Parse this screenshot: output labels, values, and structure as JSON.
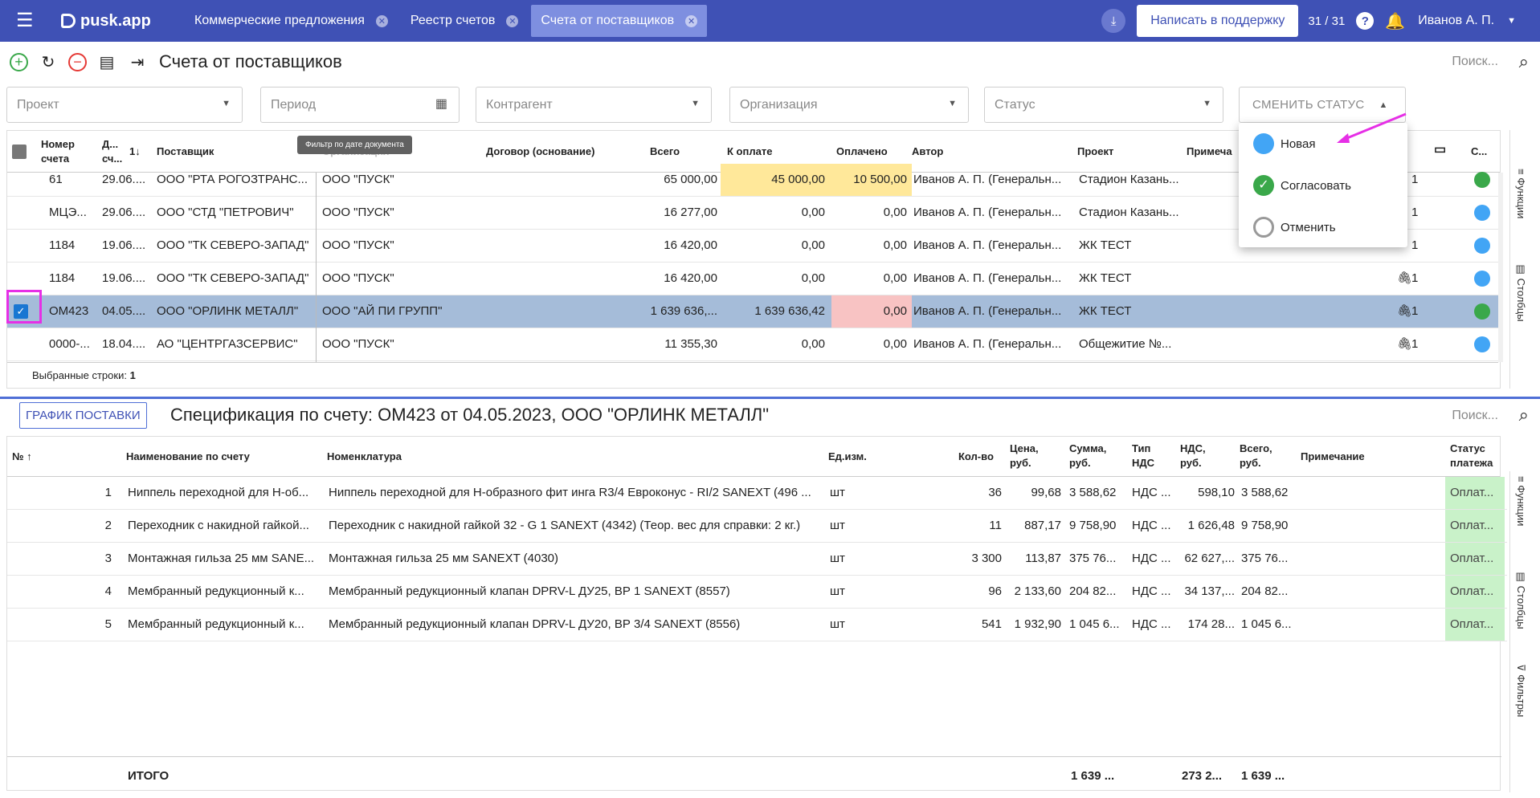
{
  "topbar": {
    "logo": "pusk.app",
    "tabs": [
      "Коммерческие предложения",
      "Реестр счетов",
      "Счета от поставщиков"
    ],
    "support": "Написать в поддержку",
    "count": "31 / 31",
    "help": "?",
    "user": "Иванов А. П."
  },
  "toolbar": {
    "title": "Счета от поставщиков",
    "search": "Поиск..."
  },
  "filters": {
    "project": "Проект",
    "period": "Период",
    "counterparty": "Контрагент",
    "organization": "Организация",
    "status": "Статус",
    "change_status": "СМЕНИТЬ СТАТУС"
  },
  "tooltip": "Фильтр по дате документа",
  "status_menu": [
    "Новая",
    "Согласовать",
    "Отменить"
  ],
  "grid1": {
    "headers": {
      "num": "Номер счета",
      "date": "Д... сч...",
      "sort": "1",
      "supplier": "Поставщик",
      "org": "Организация",
      "contract": "Договор (основание)",
      "total": "Всего",
      "to_pay": "К оплате",
      "paid": "Оплачено",
      "author": "Автор",
      "project": "Проект",
      "note": "Примеча",
      "st": "С..."
    },
    "rows": [
      {
        "num": "61",
        "date": "29.06....",
        "supplier": "ООО \"РТА РОГОЗТРАНС...",
        "org": "ООО \"ПУСК\"",
        "total": "65 000,00",
        "to_pay": "45 000,00",
        "paid": "10 500,00",
        "author": "Иванов А. П. (Генеральн...",
        "project": "Стадион Казань...",
        "att": "1",
        "status": "green"
      },
      {
        "num": "МЦЭ...",
        "date": "29.06....",
        "supplier": "ООО \"СТД \"ПЕТРОВИЧ\"",
        "org": "ООО \"ПУСК\"",
        "total": "16 277,00",
        "to_pay": "0,00",
        "paid": "0,00",
        "author": "Иванов А. П. (Генеральн...",
        "project": "Стадион Казань...",
        "att": "1",
        "status": "blue"
      },
      {
        "num": "1184",
        "date": "19.06....",
        "supplier": "ООО \"ТК СЕВЕРО-ЗАПАД\"",
        "org": "ООО \"ПУСК\"",
        "total": "16 420,00",
        "to_pay": "0,00",
        "paid": "0,00",
        "author": "Иванов А. П. (Генеральн...",
        "project": "ЖК ТЕСТ",
        "att": "1",
        "status": "blue"
      },
      {
        "num": "1184",
        "date": "19.06....",
        "supplier": "ООО \"ТК СЕВЕРО-ЗАПАД\"",
        "org": "ООО \"ПУСК\"",
        "total": "16 420,00",
        "to_pay": "0,00",
        "paid": "0,00",
        "author": "Иванов А. П. (Генеральн...",
        "project": "ЖК ТЕСТ",
        "att": "1",
        "status": "blue"
      },
      {
        "num": "ОМ423",
        "date": "04.05....",
        "supplier": "ООО \"ОРЛИНК МЕТАЛЛ\"",
        "org": "ООО \"АЙ ПИ ГРУПП\"",
        "total": "1 639 636,...",
        "to_pay": "1 639 636,42",
        "paid": "0,00",
        "author": "Иванов А. П. (Генеральн...",
        "project": "ЖК ТЕСТ",
        "att": "1",
        "status": "green"
      },
      {
        "num": "0000-...",
        "date": "18.04....",
        "supplier": "АО \"ЦЕНТРГАЗСЕРВИС\"",
        "org": "ООО \"ПУСК\"",
        "total": "11 355,30",
        "to_pay": "0,00",
        "paid": "0,00",
        "author": "Иванов А. П. (Генеральн...",
        "project": "Общежитие №...",
        "att": "1",
        "status": "blue"
      }
    ],
    "selected_label": "Выбранные строки:",
    "selected_count": "1",
    "side_functions": "Функции",
    "side_columns": "Столбцы"
  },
  "spec": {
    "schedule_btn": "ГРАФИК ПОСТАВКИ",
    "title": "Спецификация по счету: ОМ423 от 04.05.2023, ООО \"ОРЛИНК МЕТАЛЛ\"",
    "search": "Поиск...",
    "headers": {
      "no": "№",
      "name": "Наименование по счету",
      "nom": "Номенклатура",
      "unit": "Ед.изм.",
      "qty": "Кол-во",
      "price": "Цена, руб.",
      "sum": "Сумма, руб.",
      "vat_type": "Тип НДС",
      "vat": "НДС, руб.",
      "total": "Всего, руб.",
      "note": "Примечание",
      "pay": "Статус платежа"
    },
    "rows": [
      {
        "no": "1",
        "name": "Ниппель переходной для Н-об...",
        "nom": "Ниппель переходной для Н-образного фит инга R3/4 Евроконус - RI/2 SANEXT (496 ...",
        "unit": "шт",
        "qty": "36",
        "price": "99,68",
        "sum": "3 588,62",
        "vat_type": "НДС ...",
        "vat": "598,10",
        "total": "3 588,62",
        "pay": "Оплат..."
      },
      {
        "no": "2",
        "name": "Переходник с накидной гайкой...",
        "nom": "Переходник с накидной гайкой 32 - G 1 SANEXT (4342) (Теор. вес для справки: 2 кг.)",
        "unit": "шт",
        "qty": "11",
        "price": "887,17",
        "sum": "9 758,90",
        "vat_type": "НДС ...",
        "vat": "1 626,48",
        "total": "9 758,90",
        "pay": "Оплат..."
      },
      {
        "no": "3",
        "name": "Монтажная гильза 25 мм SANE...",
        "nom": "Монтажная гильза 25 мм SANEXT (4030)",
        "unit": "шт",
        "qty": "3 300",
        "price": "113,87",
        "sum": "375 76...",
        "vat_type": "НДС ...",
        "vat": "62 627,...",
        "total": "375 76...",
        "pay": "Оплат..."
      },
      {
        "no": "4",
        "name": "Мембранный редукционный к...",
        "nom": "Мембранный редукционный клапан DPRV-L ДУ25, ВР 1 SANEXT (8557)",
        "unit": "шт",
        "qty": "96",
        "price": "2 133,60",
        "sum": "204 82...",
        "vat_type": "НДС ...",
        "vat": "34 137,...",
        "total": "204 82...",
        "pay": "Оплат..."
      },
      {
        "no": "5",
        "name": "Мембранный редукционный к...",
        "nom": "Мембранный редукционный клапан DPRV-L ДУ20, ВР 3/4 SANEXT (8556)",
        "unit": "шт",
        "qty": "541",
        "price": "1 932,90",
        "sum": "1 045 6...",
        "vat_type": "НДС ...",
        "vat": "174 28...",
        "total": "1 045 6...",
        "pay": "Оплат..."
      }
    ],
    "totals": {
      "label": "ИТОГО",
      "sum": "1 639 ...",
      "vat": "273 2...",
      "total": "1 639 ..."
    },
    "side_functions": "Функции",
    "side_columns": "Столбцы",
    "side_filters": "Фильтры"
  },
  "colors": {
    "accent": "#3f51b5",
    "yellow": "#ffe89a",
    "pink": "#f8c3c3",
    "selected": "#a5bcd9",
    "green": "#3aa84a",
    "blue": "#42a5f5",
    "paid_bg": "#c9f2c9"
  }
}
